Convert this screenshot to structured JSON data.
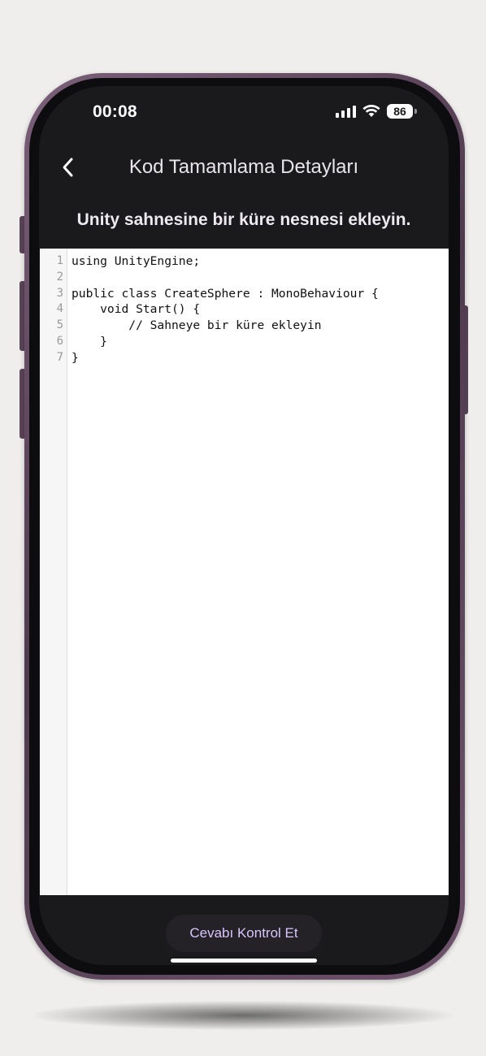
{
  "status_bar": {
    "time": "00:08",
    "battery_level": "86",
    "icons": [
      "signal-icon",
      "wifi-icon",
      "battery-icon"
    ]
  },
  "header": {
    "back_icon": "chevron-left-icon",
    "title": "Kod Tamamlama Detayları"
  },
  "task": {
    "heading": "Unity sahnesine bir küre nesnesi ekleyin."
  },
  "editor": {
    "line_numbers": [
      "1",
      "2",
      "3",
      "4",
      "5",
      "6",
      "7"
    ],
    "lines": [
      "using UnityEngine;",
      "",
      "public class CreateSphere : MonoBehaviour {",
      "    void Start() {",
      "        // Sahneye bir küre ekleyin",
      "    }",
      "}"
    ]
  },
  "actions": {
    "check_answer_label": "Cevabı Kontrol Et"
  },
  "colors": {
    "screen_background": "#1a191c",
    "accent_text": "#d8c6ff",
    "frame": "#6d536b"
  }
}
